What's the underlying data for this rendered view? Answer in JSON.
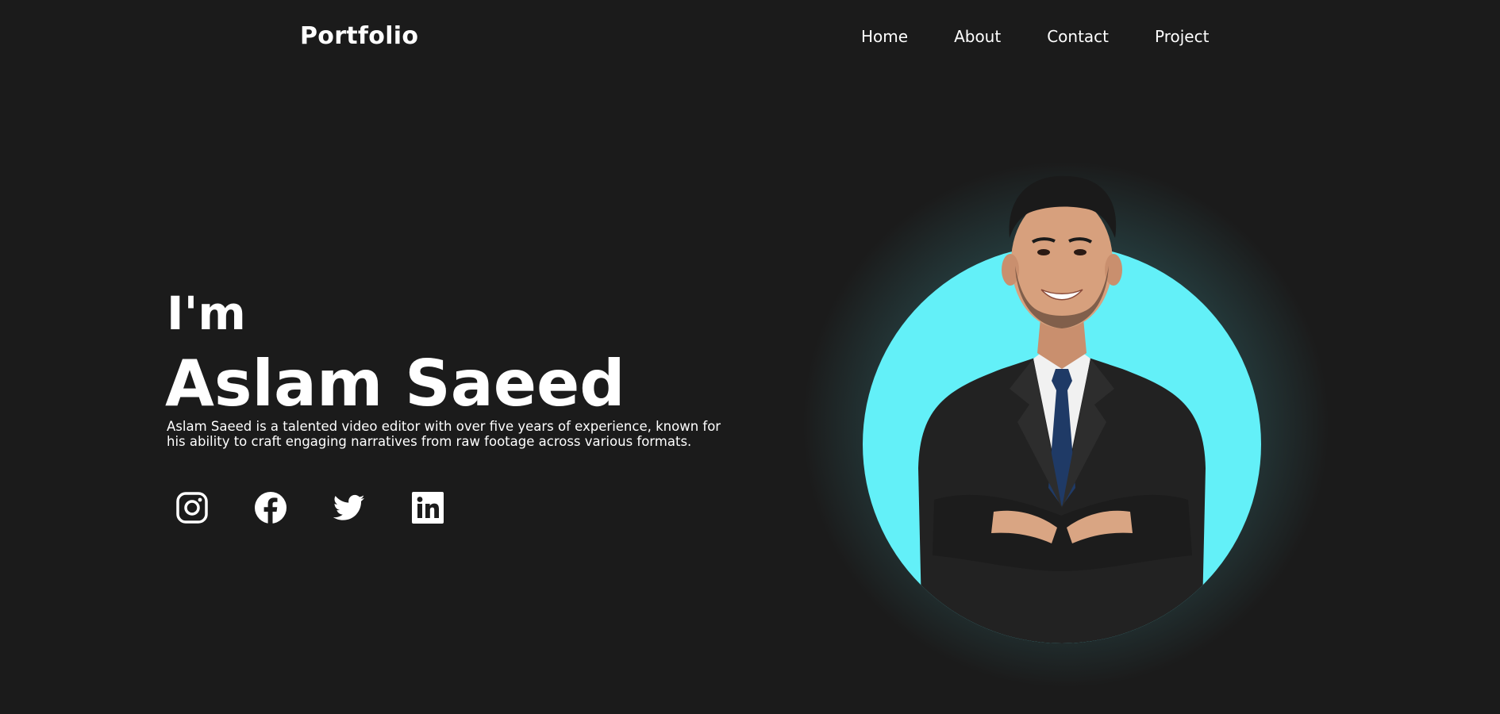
{
  "header": {
    "logo": "Portfolio",
    "nav": [
      {
        "label": "Home"
      },
      {
        "label": "About"
      },
      {
        "label": "Contact"
      },
      {
        "label": "Project"
      }
    ]
  },
  "hero": {
    "greeting": "I'm",
    "name": "Aslam Saeed",
    "description": "Aslam Saeed is a talented video editor with over five years of experience, known for his ability to craft engaging narratives from raw footage across various formats."
  },
  "socials": [
    {
      "icon": "instagram-icon"
    },
    {
      "icon": "facebook-icon"
    },
    {
      "icon": "twitter-icon"
    },
    {
      "icon": "linkedin-icon"
    }
  ],
  "colors": {
    "background": "#1b1b1b",
    "accent": "#63f0f8",
    "text": "#ffffff",
    "suit": "#222222",
    "tie": "#1f3a66"
  }
}
